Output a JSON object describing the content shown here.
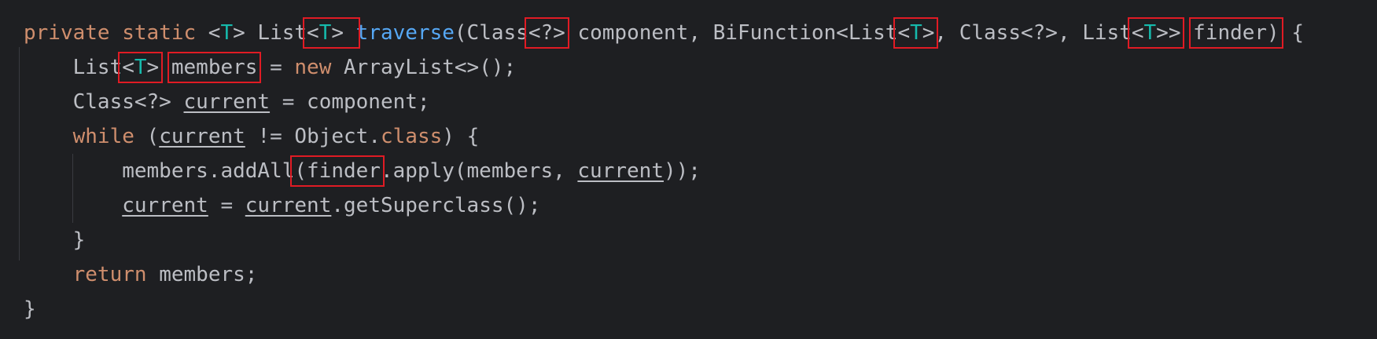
{
  "editor": {
    "lines": [
      [
        {
          "t": "private",
          "c": "kw"
        },
        {
          "t": " "
        },
        {
          "t": "static",
          "c": "kw"
        },
        {
          "t": " <"
        },
        {
          "t": "T",
          "c": "tp"
        },
        {
          "t": "> List"
        },
        {
          "t": "<",
          "m": true,
          "c": ""
        },
        {
          "t": "T",
          "c": "tp",
          "m": true
        },
        {
          "t": "> ",
          "m": true
        },
        {
          "t": "traverse",
          "c": "fn"
        },
        {
          "t": "(Class"
        },
        {
          "t": "<?>",
          "m": true
        },
        {
          "t": " component, BiFunction<List"
        },
        {
          "t": "<",
          "m": true
        },
        {
          "t": "T",
          "c": "tp",
          "m": true
        },
        {
          "t": ">",
          "m": true
        },
        {
          "t": ", Class<?>, List"
        },
        {
          "t": "<",
          "m": true
        },
        {
          "t": "T",
          "c": "tp",
          "m": true
        },
        {
          "t": ">>",
          "m": true
        },
        {
          "t": " "
        },
        {
          "t": "finder)",
          "m": true
        },
        {
          "t": " {"
        }
      ],
      [
        {
          "t": "    List"
        },
        {
          "t": "<",
          "m": true
        },
        {
          "t": "T",
          "c": "tp",
          "m": true
        },
        {
          "t": ">",
          "m": true
        },
        {
          "t": " "
        },
        {
          "t": "members",
          "m": true
        },
        {
          "t": " = "
        },
        {
          "t": "new",
          "c": "kw"
        },
        {
          "t": " ArrayList<>();"
        }
      ],
      [
        {
          "t": "    Class<?> "
        },
        {
          "t": "current",
          "c": "ul"
        },
        {
          "t": " = component;"
        }
      ],
      [
        {
          "t": "    "
        },
        {
          "t": "while",
          "c": "kw"
        },
        {
          "t": " ("
        },
        {
          "t": "current",
          "c": "ul"
        },
        {
          "t": " != Object."
        },
        {
          "t": "class",
          "c": "kw"
        },
        {
          "t": ") {"
        }
      ],
      [
        {
          "t": "        members.addAll"
        },
        {
          "t": "(finder",
          "m": true
        },
        {
          "t": ".apply(members, "
        },
        {
          "t": "current",
          "c": "ul"
        },
        {
          "t": "));"
        }
      ],
      [
        {
          "t": "        "
        },
        {
          "t": "current",
          "c": "ul"
        },
        {
          "t": " = "
        },
        {
          "t": "current",
          "c": "ul"
        },
        {
          "t": ".getSuperclass();"
        }
      ],
      [
        {
          "t": "    }"
        }
      ],
      [
        {
          "t": "    "
        },
        {
          "t": "return",
          "c": "kw"
        },
        {
          "t": " members;"
        }
      ],
      [
        {
          "t": "}"
        }
      ]
    ]
  }
}
